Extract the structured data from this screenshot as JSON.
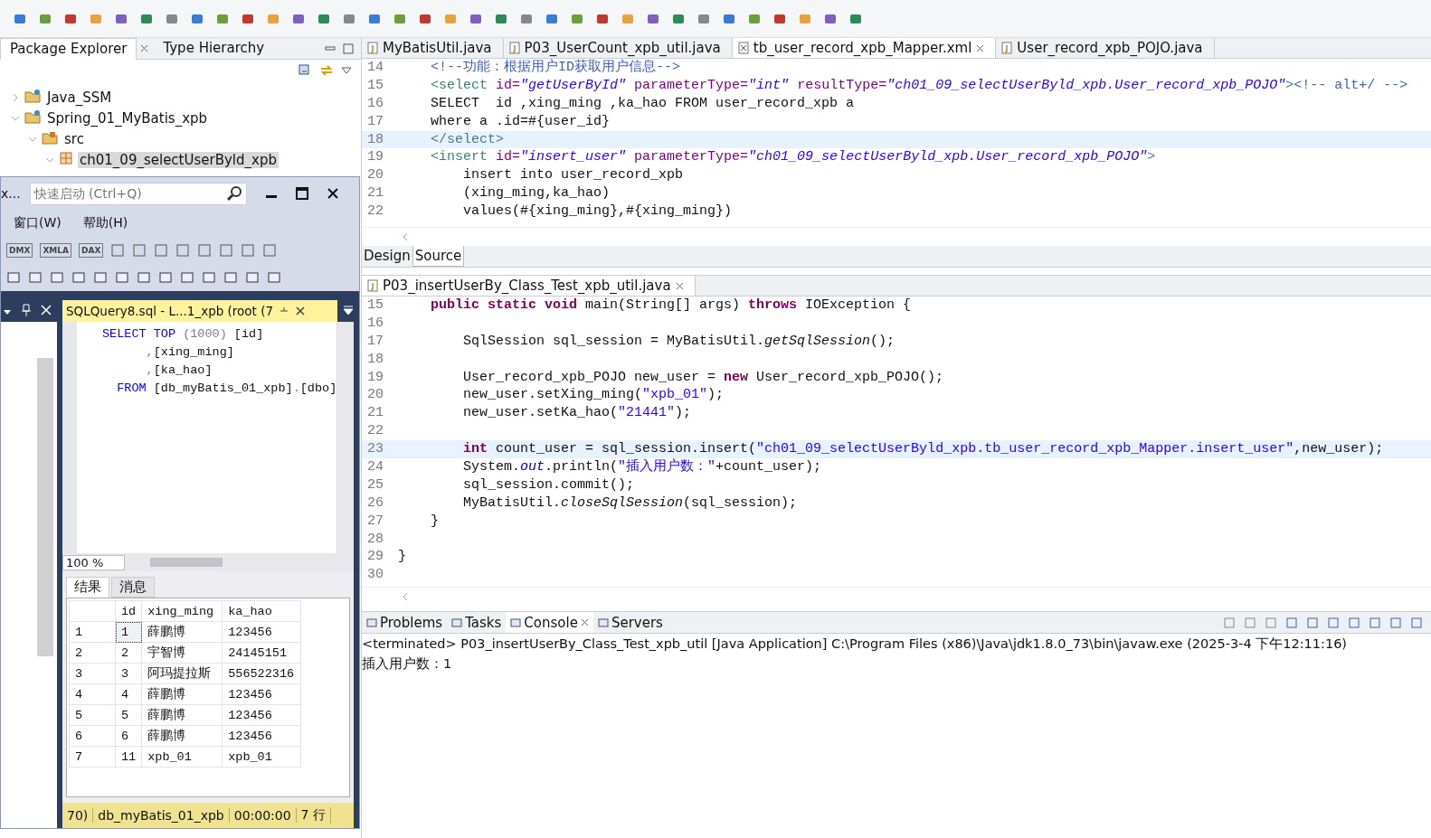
{
  "package_explorer": {
    "tabs": [
      {
        "label": "Package Explorer",
        "selected": true
      },
      {
        "label": "Type Hierarchy",
        "selected": false
      }
    ],
    "tree": [
      {
        "label": "Java_SSM",
        "kind": "project",
        "expanded": false,
        "selected": false
      },
      {
        "label": "Spring_01_MyBatis_xpb",
        "kind": "project",
        "expanded": true,
        "selected": false,
        "children": [
          {
            "label": "src",
            "kind": "folder",
            "expanded": true,
            "selected": false,
            "children": [
              {
                "label": "ch01_09_selectUserByld_xpb",
                "kind": "package",
                "expanded": true,
                "selected": true
              }
            ]
          }
        ]
      }
    ]
  },
  "xml_editor": {
    "tabs": [
      {
        "label": "MyBatisUtil.java",
        "kind": "java",
        "selected": false
      },
      {
        "label": "P03_UserCount_xpb_util.java",
        "kind": "java",
        "selected": false
      },
      {
        "label": "tb_user_record_xpb_Mapper.xml",
        "kind": "xml",
        "selected": true
      },
      {
        "label": "User_record_xpb_POJO.java",
        "kind": "java",
        "selected": false
      }
    ],
    "lines": [
      {
        "num": "14",
        "segments": [
          {
            "text": "    <!--功能：根据用户ID获取用户信息-->",
            "kind": "comment"
          }
        ]
      },
      {
        "num": "15",
        "segments": [
          {
            "text": "    <select ",
            "kind": "tag"
          },
          {
            "text": "id=",
            "kind": "attr"
          },
          {
            "text": "\"getUserById\"",
            "kind": "attrval"
          },
          {
            "text": " parameterType=",
            "kind": "attr"
          },
          {
            "text": "\"int\"",
            "kind": "attrval"
          },
          {
            "text": " resultType=",
            "kind": "attr"
          },
          {
            "text": "\"ch01_09_selectUserByld_xpb.User_record_xpb_POJO\"",
            "kind": "attrval"
          },
          {
            "text": ">",
            "kind": "tag"
          },
          {
            "text": "<!-- alt+/ -->",
            "kind": "comment"
          }
        ]
      },
      {
        "num": "16",
        "segments": [
          {
            "text": "    SELECT  id ,xing_ming ,ka_hao FROM user_record_xpb a",
            "kind": "plain"
          }
        ]
      },
      {
        "num": "17",
        "segments": [
          {
            "text": "    where a .id=#{user_id}",
            "kind": "plain"
          }
        ]
      },
      {
        "num": "18",
        "current": true,
        "segments": [
          {
            "text": "    </select>",
            "kind": "tag"
          }
        ]
      },
      {
        "num": "19",
        "segments": [
          {
            "text": "    <insert ",
            "kind": "tag"
          },
          {
            "text": "id=",
            "kind": "attr"
          },
          {
            "text": "\"insert_user\"",
            "kind": "attrval"
          },
          {
            "text": " parameterType=",
            "kind": "attr"
          },
          {
            "text": "\"ch01_09_selectUserByld_xpb.User_record_xpb_POJO\"",
            "kind": "attrval"
          },
          {
            "text": ">",
            "kind": "tag"
          }
        ]
      },
      {
        "num": "20",
        "segments": [
          {
            "text": "        insert into user_record_xpb",
            "kind": "plain"
          }
        ]
      },
      {
        "num": "21",
        "segments": [
          {
            "text": "        (xing_ming,ka_hao)",
            "kind": "plain"
          }
        ]
      },
      {
        "num": "22",
        "segments": [
          {
            "text": "        values(#{xing_ming},#{xing_ming})",
            "kind": "plain"
          }
        ]
      }
    ],
    "view_tabs": [
      {
        "label": "Design",
        "selected": false
      },
      {
        "label": "Source",
        "selected": true
      }
    ]
  },
  "java_editor": {
    "tab": "P03_insertUserBy_Class_Test_xpb_util.java",
    "lines": [
      {
        "num": "15",
        "segments": [
          {
            "text": "    public static void",
            "kind": "kw"
          },
          {
            "text": " main(String[] args) ",
            "kind": "plain"
          },
          {
            "text": "throws",
            "kind": "kw"
          },
          {
            "text": " IOException {",
            "kind": "plain"
          }
        ]
      },
      {
        "num": "16"
      },
      {
        "num": "17",
        "segments": [
          {
            "text": "        SqlSession sql_session = MyBatisUtil.",
            "kind": "plain"
          },
          {
            "text": "getSqlSession",
            "kind": "italic"
          },
          {
            "text": "();",
            "kind": "plain"
          }
        ]
      },
      {
        "num": "18"
      },
      {
        "num": "19",
        "segments": [
          {
            "text": "        User_record_xpb_POJO new_user = ",
            "kind": "plain"
          },
          {
            "text": "new",
            "kind": "kw"
          },
          {
            "text": " User_record_xpb_POJO();",
            "kind": "plain"
          }
        ]
      },
      {
        "num": "20",
        "segments": [
          {
            "text": "        new_user.setXing_ming(",
            "kind": "plain"
          },
          {
            "text": "\"xpb_01\"",
            "kind": "str"
          },
          {
            "text": ");",
            "kind": "plain"
          }
        ]
      },
      {
        "num": "21",
        "segments": [
          {
            "text": "        new_user.setKa_hao(",
            "kind": "plain"
          },
          {
            "text": "\"21441\"",
            "kind": "str"
          },
          {
            "text": ");",
            "kind": "plain"
          }
        ]
      },
      {
        "num": "22"
      },
      {
        "num": "23",
        "current": true,
        "segments": [
          {
            "text": "        int",
            "kind": "kw"
          },
          {
            "text": " count_user = sql_session.insert(",
            "kind": "plain"
          },
          {
            "text": "\"ch01_09_selectUserByld_xpb.tb_user_record_xpb_Mapper.insert_user\"",
            "kind": "str"
          },
          {
            "text": ",new_user);",
            "kind": "plain"
          }
        ]
      },
      {
        "num": "24",
        "segments": [
          {
            "text": "        System.",
            "kind": "plain"
          },
          {
            "text": "out",
            "kind": "field"
          },
          {
            "text": ".println(",
            "kind": "plain"
          },
          {
            "text": "\"插入用户数：\"",
            "kind": "str"
          },
          {
            "text": "+count_user);",
            "kind": "plain"
          }
        ]
      },
      {
        "num": "25",
        "segments": [
          {
            "text": "        sql_session.commit();",
            "kind": "plain"
          }
        ]
      },
      {
        "num": "26",
        "segments": [
          {
            "text": "        MyBatisUtil.",
            "kind": "plain"
          },
          {
            "text": "closeSqlSession",
            "kind": "italic"
          },
          {
            "text": "(sql_session);",
            "kind": "plain"
          }
        ]
      },
      {
        "num": "27",
        "segments": [
          {
            "text": "    }",
            "kind": "plain"
          }
        ]
      },
      {
        "num": "28"
      },
      {
        "num": "29",
        "segments": [
          {
            "text": "}",
            "kind": "plain"
          }
        ]
      },
      {
        "num": "30"
      }
    ]
  },
  "console": {
    "tabs": [
      {
        "label": "Problems",
        "selected": false
      },
      {
        "label": "Tasks",
        "selected": false
      },
      {
        "label": "Console",
        "selected": true
      },
      {
        "label": "Servers",
        "selected": false
      }
    ],
    "header": "<terminated> P03_insertUserBy_Class_Test_xpb_util [Java Application] C:\\Program Files (x86)\\Java\\jdk1.8.0_73\\bin\\javaw.exe (2025-3-4 下午12:11:16)",
    "output": "插入用户数：1"
  },
  "ssms": {
    "title": "x...",
    "quick_launch": {
      "placeholder": "快速启动 (Ctrl+Q)"
    },
    "menu": [
      "窗口(W)",
      "帮助(H)"
    ],
    "toolbar_labels": [
      "DMX",
      "XMLA",
      "DAX"
    ],
    "query_tab": "SQLQuery8.sql - L...1_xpb (root (7",
    "sql_lines": [
      {
        "segments": [
          {
            "text": "SELECT TOP ",
            "kind": "kw"
          },
          {
            "text": "(1000)",
            "kind": "paren"
          },
          {
            "text": " [id]",
            "kind": "plain"
          }
        ]
      },
      {
        "segments": [
          {
            "text": "      ,",
            "kind": "paren"
          },
          {
            "text": "[xing_ming]",
            "kind": "plain"
          }
        ]
      },
      {
        "segments": [
          {
            "text": "      ,",
            "kind": "paren"
          },
          {
            "text": "[ka_hao]",
            "kind": "plain"
          }
        ]
      },
      {
        "segments": [
          {
            "text": "  FROM ",
            "kind": "kw"
          },
          {
            "text": "[db_myBatis_01_xpb]",
            "kind": "plain"
          },
          {
            "text": ".",
            "kind": "paren"
          },
          {
            "text": "[dbo]",
            "kind": "plain"
          }
        ]
      }
    ],
    "zoom": "100 %",
    "result_tabs": [
      {
        "label": "结果",
        "selected": true
      },
      {
        "label": "消息",
        "selected": false
      }
    ],
    "columns": [
      "id",
      "xing_ming",
      "ka_hao"
    ],
    "rows": [
      {
        "row": "1",
        "cells": [
          "1",
          "薛鹏博",
          "123456"
        ]
      },
      {
        "row": "2",
        "cells": [
          "2",
          "宇智博",
          "24145151"
        ]
      },
      {
        "row": "3",
        "cells": [
          "3",
          "阿玛提拉斯",
          "556522316"
        ]
      },
      {
        "row": "4",
        "cells": [
          "4",
          "薛鹏博",
          "123456"
        ]
      },
      {
        "row": "5",
        "cells": [
          "5",
          "薛鹏博",
          "123456"
        ]
      },
      {
        "row": "6",
        "cells": [
          "6",
          "薛鹏博",
          "123456"
        ]
      },
      {
        "row": "7",
        "cells": [
          "11",
          "xpb_01",
          "xpb_01"
        ]
      }
    ],
    "status": [
      "70)",
      "db_myBatis_01_xpb",
      "00:00:00",
      "7 行"
    ]
  }
}
